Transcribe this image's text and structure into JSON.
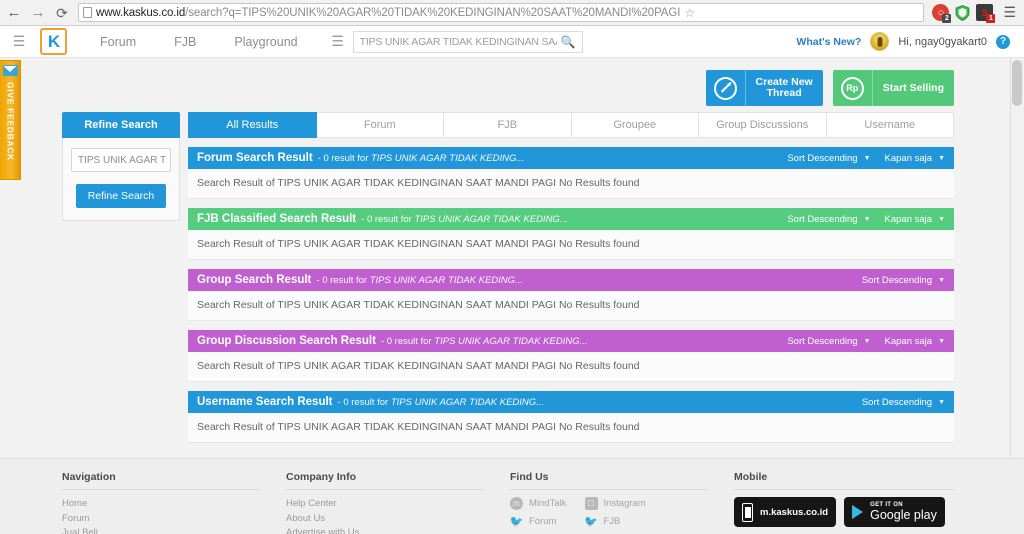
{
  "browser": {
    "back_icon": "back-arrow-icon",
    "forward_icon": "forward-arrow-icon",
    "reload_icon": "reload-icon",
    "url_host": "www.kaskus.co.id",
    "url_path": "/search?q=TIPS%20UNIK%20AGAR%20TIDAK%20KEDINGINAN%20SAAT%20MANDI%20PAGI",
    "bookmark_icon": "star-icon",
    "extensions": [
      {
        "name": "adblock-extension",
        "badge": "2"
      },
      {
        "name": "shield-extension",
        "badge": ""
      },
      {
        "name": "noscript-extension",
        "badge": "1",
        "glyph": "S"
      }
    ],
    "menu_icon": "browser-menu-icon"
  },
  "header": {
    "menu_icon": "site-menu-icon",
    "logo_letter": "K",
    "nav": [
      {
        "label": "Forum"
      },
      {
        "label": "FJB"
      },
      {
        "label": "Playground"
      }
    ],
    "search_menu_icon": "search-category-icon",
    "search_value": "TIPS UNIK AGAR TIDAK KEDINGINAN SAAT M",
    "search_icon": "search-icon",
    "whats_new": "What's New?",
    "avatar": "user-avatar",
    "greeting": "Hi, ngay0gyakart0",
    "help_icon": "help-icon"
  },
  "feedback": {
    "label": "GIVE FEEDBACK",
    "icon": "envelope-icon"
  },
  "actions": {
    "create_thread": {
      "label": "Create New\nThread",
      "icon": "pencil-icon",
      "color": "#2196d8"
    },
    "start_selling": {
      "label": "Start Selling",
      "icon": "rupiah-icon",
      "glyph": "Rp",
      "color": "#53c878"
    }
  },
  "sidebar": {
    "header": "Refine Search",
    "input_value": "TIPS UNIK AGAR T",
    "button": "Refine Search"
  },
  "tabs": [
    {
      "label": "All Results",
      "active": true
    },
    {
      "label": "Forum",
      "active": false
    },
    {
      "label": "FJB",
      "active": false
    },
    {
      "label": "Groupee",
      "active": false
    },
    {
      "label": "Group Discussions",
      "active": false
    },
    {
      "label": "Username",
      "active": false
    }
  ],
  "sections": [
    {
      "title": "Forum Search Result",
      "count_text": "- 0 result for",
      "query_short": "TIPS UNIK AGAR TIDAK KEDING...",
      "sort": "Sort Descending",
      "time": "Kapan saja",
      "body": "Search Result of TIPS UNIK AGAR TIDAK KEDINGINAN SAAT MANDI PAGI No Results found",
      "color": "#2196d8",
      "style": "hd-blue",
      "has_time": true
    },
    {
      "title": "FJB Classified Search Result",
      "count_text": "- 0 result for",
      "query_short": "TIPS UNIK AGAR TIDAK KEDING...",
      "sort": "Sort Descending",
      "time": "Kapan saja",
      "body": "Search Result of TIPS UNIK AGAR TIDAK KEDINGINAN SAAT MANDI PAGI No Results found",
      "color": "#55cc80",
      "style": "hd-green",
      "has_time": true
    },
    {
      "title": "Group Search Result",
      "count_text": "- 0 result for",
      "query_short": "TIPS UNIK AGAR TIDAK KEDING...",
      "sort": "Sort Descending",
      "time": "",
      "body": "Search Result of TIPS UNIK AGAR TIDAK KEDINGINAN SAAT MANDI PAGI No Results found",
      "color": "#c060d0",
      "style": "hd-magenta",
      "has_time": false
    },
    {
      "title": "Group Discussion Search Result",
      "count_text": "- 0 result for",
      "query_short": "TIPS UNIK AGAR TIDAK KEDING...",
      "sort": "Sort Descending",
      "time": "Kapan saja",
      "body": "Search Result of TIPS UNIK AGAR TIDAK KEDINGINAN SAAT MANDI PAGI No Results found",
      "color": "#c060d0",
      "style": "hd-magenta",
      "has_time": true
    },
    {
      "title": "Username Search Result",
      "count_text": "- 0 result for",
      "query_short": "TIPS UNIK AGAR TIDAK KEDING...",
      "sort": "Sort Descending",
      "time": "",
      "body": "Search Result of TIPS UNIK AGAR TIDAK KEDINGINAN SAAT MANDI PAGI No Results found",
      "color": "#2196d8",
      "style": "hd-blue",
      "has_time": false
    }
  ],
  "footer": {
    "navigation": {
      "title": "Navigation",
      "links": [
        "Home",
        "Forum",
        "Jual Beli"
      ]
    },
    "company": {
      "title": "Company Info",
      "links": [
        "Help Center",
        "About Us",
        "Advertise with Us"
      ]
    },
    "find_us": {
      "title": "Find Us",
      "items": [
        {
          "label": "MindTalk",
          "icon": "mindtalk-icon"
        },
        {
          "label": "Instagram",
          "icon": "instagram-icon"
        },
        {
          "label": "Forum",
          "icon": "twitter-icon"
        },
        {
          "label": "FJB",
          "icon": "twitter-icon"
        }
      ]
    },
    "mobile": {
      "title": "Mobile",
      "web_label": "m.kaskus.co.id",
      "store_small": "GET IT ON",
      "store_big": "Google play"
    }
  }
}
